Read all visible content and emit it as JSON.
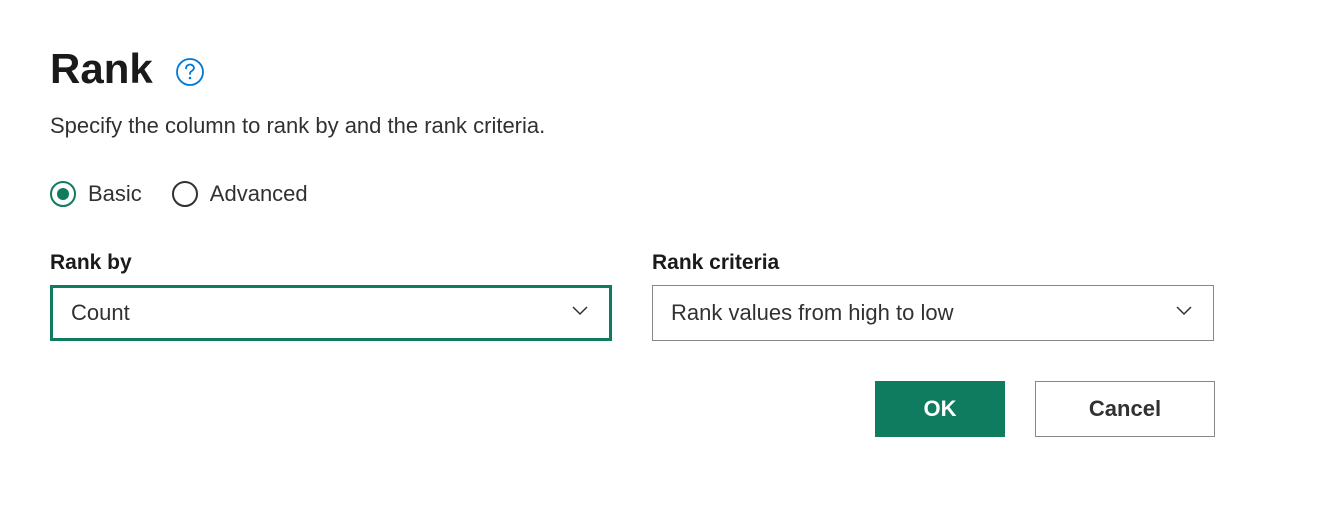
{
  "header": {
    "title": "Rank"
  },
  "subtitle": "Specify the column to rank by and the rank criteria.",
  "mode": {
    "basic_label": "Basic",
    "advanced_label": "Advanced",
    "selected": "basic"
  },
  "fields": {
    "rank_by": {
      "label": "Rank by",
      "value": "Count"
    },
    "rank_criteria": {
      "label": "Rank criteria",
      "value": "Rank values from high to low"
    }
  },
  "actions": {
    "ok": "OK",
    "cancel": "Cancel"
  },
  "colors": {
    "accent": "#0f7b5f",
    "help_icon": "#0078d4"
  }
}
